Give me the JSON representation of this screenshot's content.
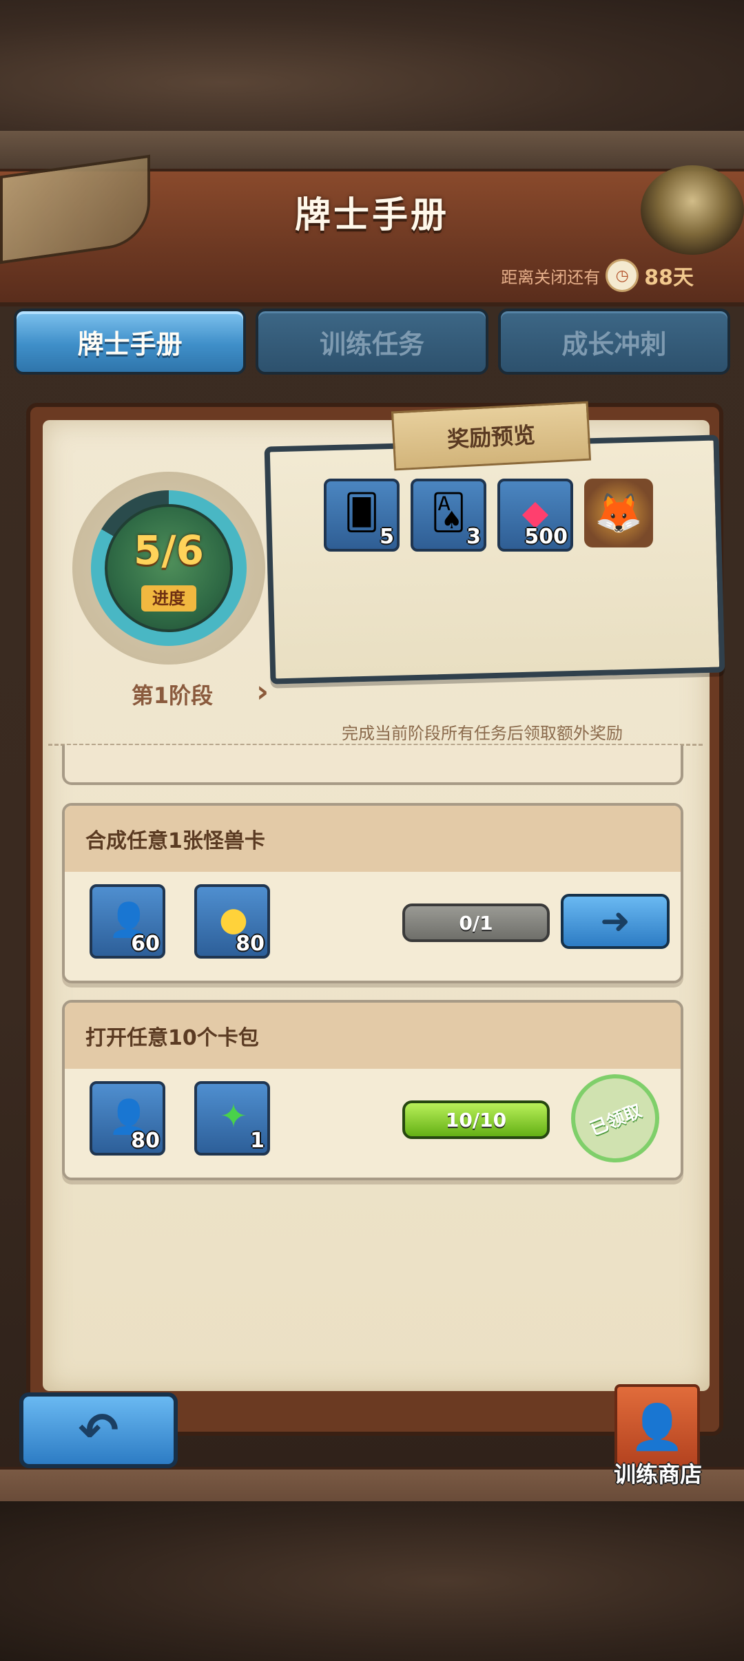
{
  "header": {
    "title": "牌士手册",
    "countdown_label": "距离关闭还有",
    "countdown_days": "88天"
  },
  "tabs": [
    {
      "label": "牌士手册",
      "active": true
    },
    {
      "label": "训练任务",
      "active": false
    },
    {
      "label": "成长冲刺",
      "active": false
    }
  ],
  "progress": {
    "value": "5/6",
    "label": "进度",
    "fraction": 0.833,
    "stage": "第1阶段"
  },
  "reward_preview": {
    "title": "奖励预览",
    "items": [
      {
        "icon": "bronze-card-pack-icon",
        "qty": "5"
      },
      {
        "icon": "purple-card-pack-icon",
        "qty": "3"
      },
      {
        "icon": "red-gem-icon",
        "qty": "500"
      },
      {
        "icon": "fox-knight-hero-icon",
        "qty": ""
      }
    ],
    "hint": "完成当前阶段所有任务后领取额外奖励"
  },
  "tasks": [
    {
      "title": "合成任意1张怪兽卡",
      "rewards": [
        {
          "icon": "trainer-xp-icon",
          "qty": "60"
        },
        {
          "icon": "gold-coin-icon",
          "qty": "80"
        }
      ],
      "progress": "0/1",
      "fraction": 0,
      "status": "go"
    },
    {
      "title": "打开任意10个卡包",
      "rewards": [
        {
          "icon": "trainer-xp-icon",
          "qty": "80"
        },
        {
          "icon": "green-crystal-icon",
          "qty": "1"
        }
      ],
      "progress": "10/10",
      "fraction": 1,
      "status": "claimed",
      "status_label": "已领取"
    }
  ],
  "footer": {
    "shop_label": "训练商店"
  },
  "colors": {
    "tab_active": "#3f8fc9",
    "tab_inactive": "#2d516d",
    "header": "#6c3822",
    "paper": "#efe5cd",
    "progress_full": "#64b015",
    "stamp": "#7fcf6a"
  }
}
